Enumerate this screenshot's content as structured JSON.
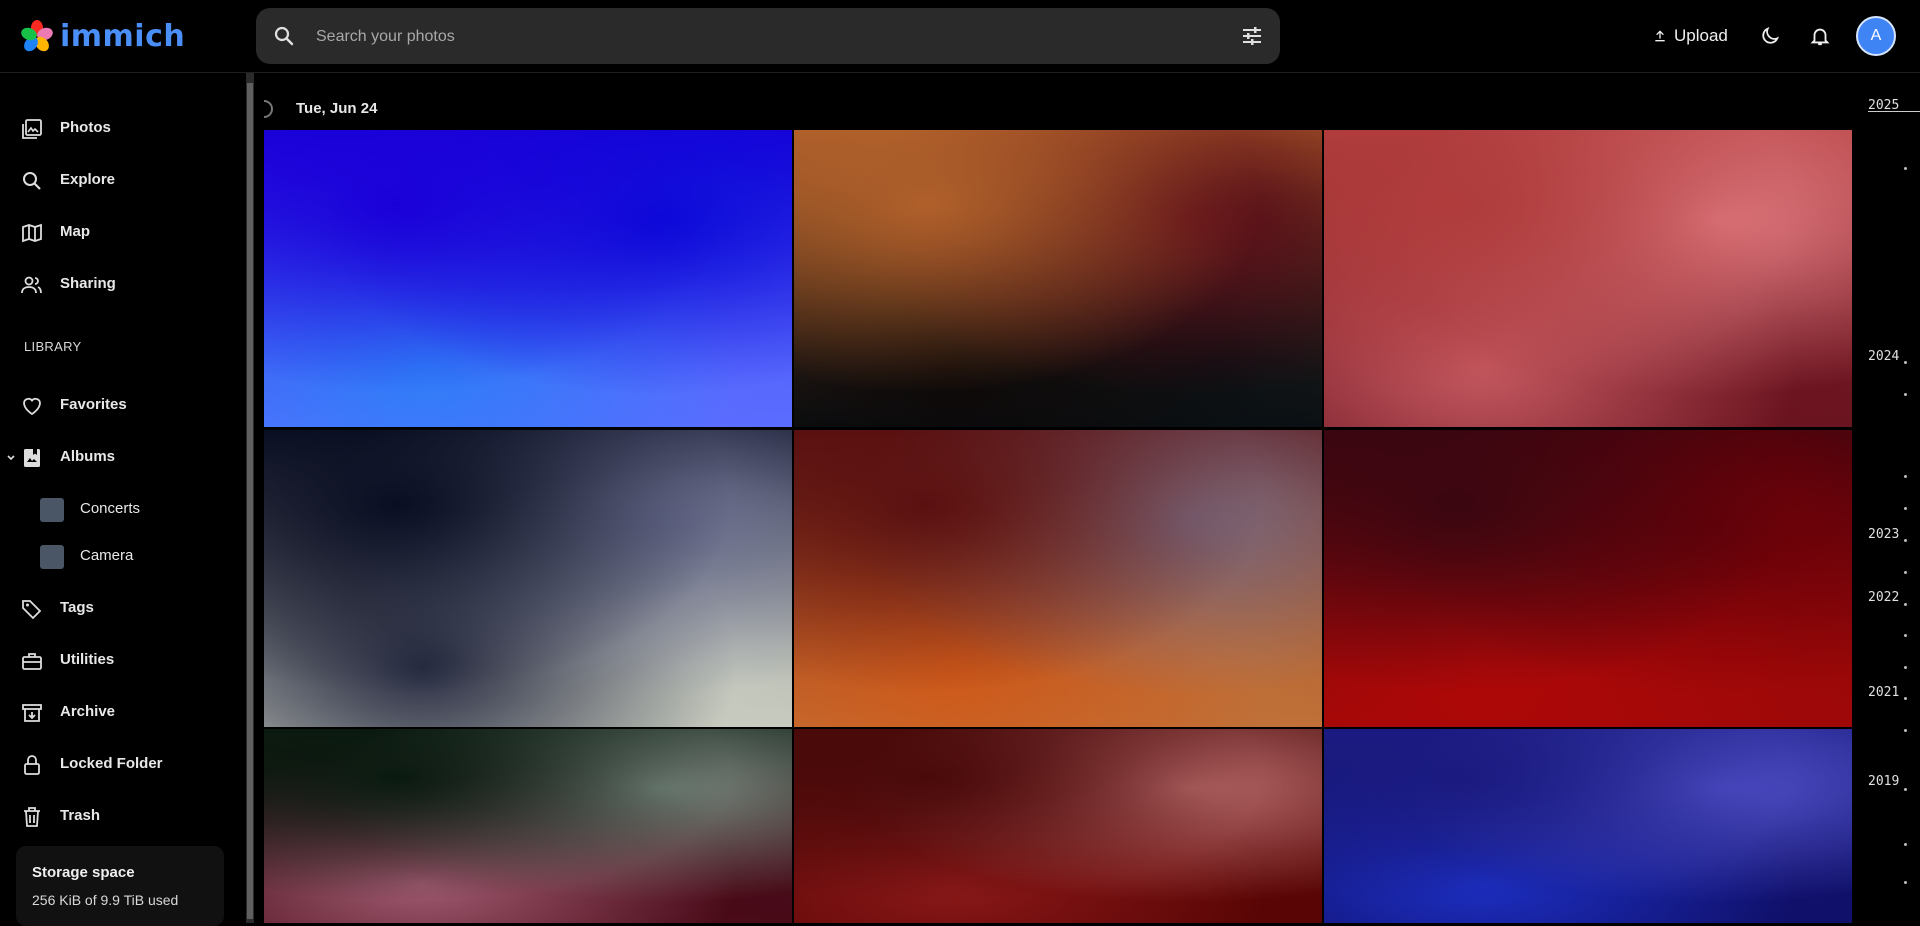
{
  "app": {
    "name": "immich"
  },
  "search": {
    "placeholder": "Search your photos"
  },
  "header": {
    "upload_label": "Upload",
    "avatar_initial": "A"
  },
  "sidebar": {
    "items": [
      {
        "label": "Photos",
        "icon": "photos-icon"
      },
      {
        "label": "Explore",
        "icon": "search-icon"
      },
      {
        "label": "Map",
        "icon": "map-icon"
      },
      {
        "label": "Sharing",
        "icon": "people-icon"
      }
    ],
    "library_label": "LIBRARY",
    "library_items": [
      {
        "label": "Favorites",
        "icon": "heart-icon"
      },
      {
        "label": "Albums",
        "icon": "album-icon"
      }
    ],
    "albums": [
      {
        "label": "Concerts"
      },
      {
        "label": "Camera"
      }
    ],
    "more_items": [
      {
        "label": "Tags",
        "icon": "tag-icon"
      },
      {
        "label": "Utilities",
        "icon": "toolbox-icon"
      },
      {
        "label": "Archive",
        "icon": "archive-icon"
      },
      {
        "label": "Locked Folder",
        "icon": "lock-icon"
      },
      {
        "label": "Trash",
        "icon": "trash-icon"
      }
    ],
    "storage": {
      "title": "Storage space",
      "usage": "256 KiB of 9.9 TiB used"
    }
  },
  "main": {
    "date_group": "Tue, Jun 24",
    "photos": [
      {
        "colors": [
          "#1a00d8",
          "#0a0ad8",
          "#2f7ff8",
          "#5a6dff"
        ]
      },
      {
        "colors": [
          "#b0602a",
          "#5a0a18",
          "#0c0808",
          "#0a1014"
        ]
      },
      {
        "colors": [
          "#b03c3c",
          "#e07a80",
          "#c45860",
          "#6a1420"
        ]
      },
      {
        "colors": [
          "#0a0e22",
          "#6a6e90",
          "#2a2e44",
          "#c8ccc0"
        ]
      },
      {
        "colors": [
          "#5a1010",
          "#7a6a80",
          "#d05a1a",
          "#c07038"
        ]
      },
      {
        "colors": [
          "#3a0610",
          "#6a0008",
          "#b00808",
          "#a00808"
        ]
      },
      {
        "colors": [
          "#0a1a10",
          "#7a8a80",
          "#a05a70",
          "#4a0a18"
        ]
      },
      {
        "colors": [
          "#4a0a0a",
          "#b86a6a",
          "#8a1818",
          "#5a0505"
        ]
      },
      {
        "colors": [
          "#1a1a80",
          "#5050c8",
          "#1c2ec0",
          "#10106a"
        ]
      }
    ]
  },
  "timeline": {
    "years": [
      "2025",
      "2024",
      "2023",
      "2022",
      "2021",
      "2019"
    ]
  }
}
